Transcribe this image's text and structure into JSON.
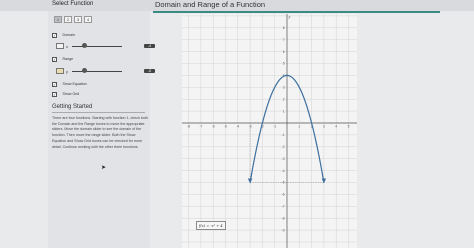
{
  "header": {
    "sidebar_title": "Select Function",
    "main_title": "Domain and Range of a Function"
  },
  "function_tabs": [
    "1",
    "2",
    "3",
    "4"
  ],
  "domain": {
    "label": "Domain",
    "checked": true,
    "var": "x",
    "value": "-4"
  },
  "range": {
    "label": "Range",
    "checked": true,
    "var": "y",
    "value": "-5"
  },
  "options": {
    "show_equation": {
      "label": "Show Equation",
      "checked": true
    },
    "show_grid": {
      "label": "Show Grid",
      "checked": true
    }
  },
  "getting_started": {
    "title": "Getting Started",
    "text": "There are four functions. Starting with function 1, check both the Domain and the Range boxes to move the appropriate sliders. Move the domain slider to see the domain of the function. Then move the range slider. Both the Show Equation and Show Grid boxes can be checked for more detail. Continue working with the other three functions."
  },
  "equation": {
    "text": "f(x) = -x² + 4"
  },
  "graph": {
    "x_ticks": [
      "-8",
      "-7",
      "-6",
      "-5",
      "-4",
      "-3",
      "-2",
      "-1",
      "1",
      "2",
      "3",
      "4",
      "5",
      "6",
      "7",
      "8"
    ],
    "y_ticks": [
      "8",
      "7",
      "6",
      "5",
      "4",
      "3",
      "2",
      "1",
      "-1",
      "-2",
      "-3",
      "-4",
      "-5",
      "-6",
      "-7",
      "-8",
      "-9"
    ],
    "y_label": "y",
    "curve_color": "#3d6f9e",
    "guide_color": "#9b9b9b",
    "domain_marker": -3,
    "range_marker": -5
  }
}
